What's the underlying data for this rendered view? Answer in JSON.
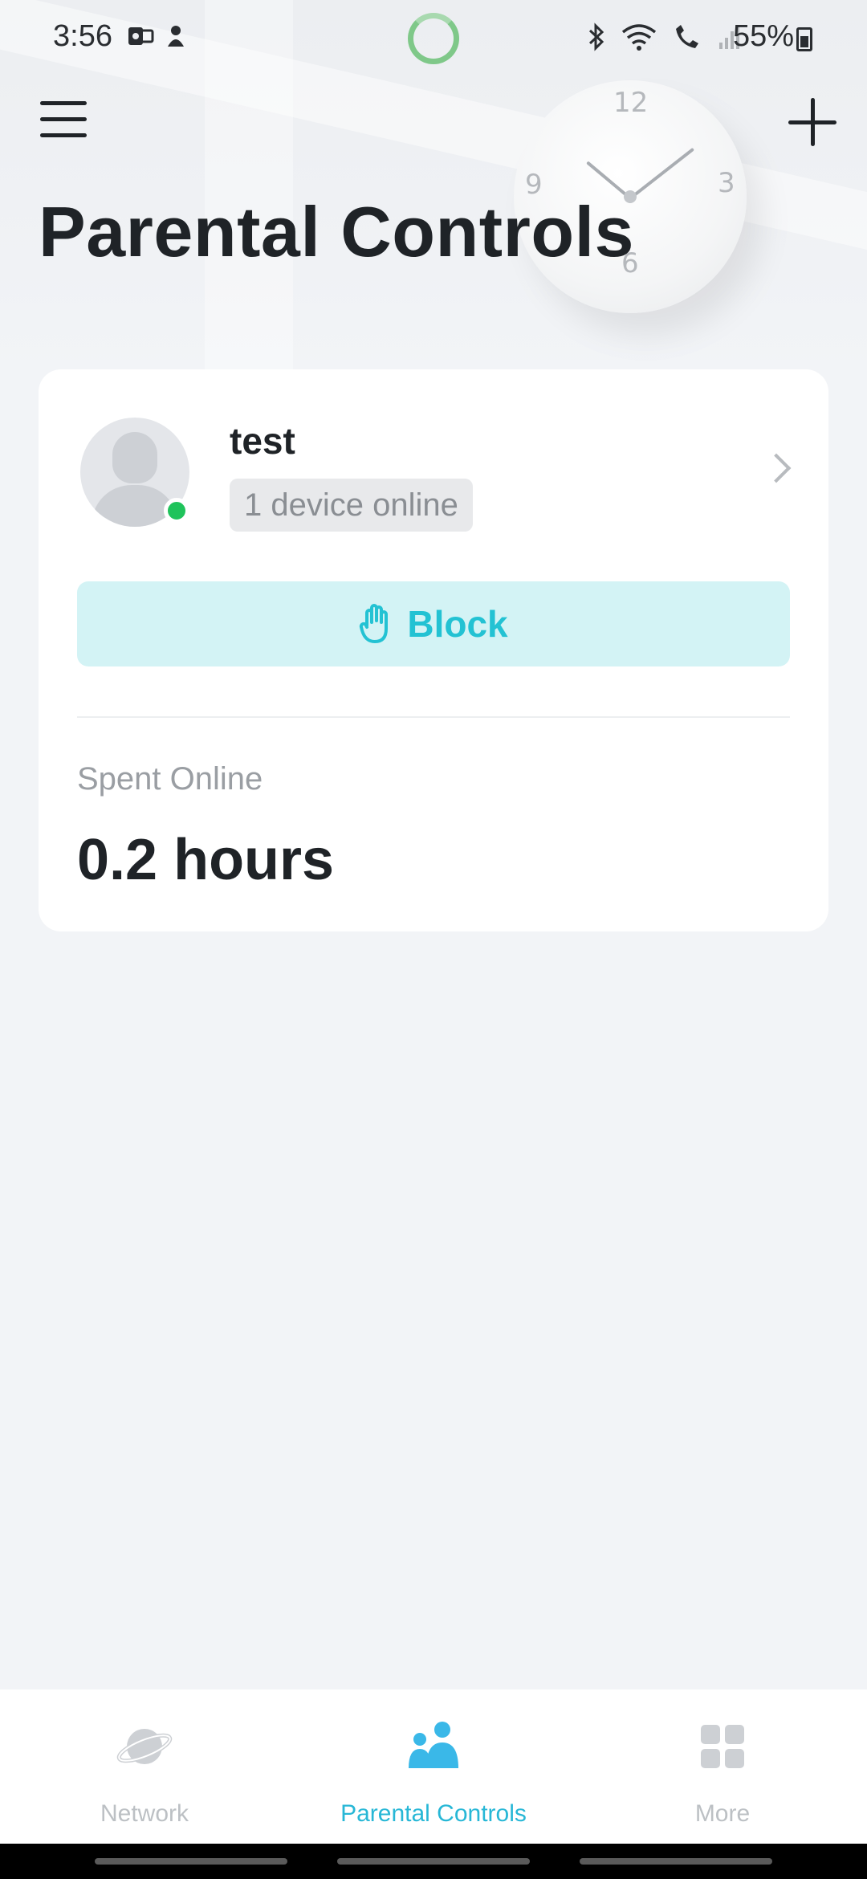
{
  "status_bar": {
    "time": "3:56",
    "battery": "55%"
  },
  "header": {
    "title": "Parental Controls"
  },
  "profile_card": {
    "name": "test",
    "device_status": "1 device online",
    "block_label": "Block",
    "spent_online_label": "Spent Online",
    "spent_online_value": "0.2 hours"
  },
  "clock_numbers": {
    "twelve": "12",
    "three": "3",
    "six": "6",
    "nine": "9"
  },
  "bottom_nav": {
    "items": [
      {
        "label": "Network",
        "icon": "planet-icon",
        "active": false
      },
      {
        "label": "Parental Controls",
        "icon": "family-icon",
        "active": true
      },
      {
        "label": "More",
        "icon": "grid-icon",
        "active": false
      }
    ]
  },
  "colors": {
    "accent": "#27b7d6",
    "block_bg": "#d3f3f5",
    "online": "#1fc35b"
  }
}
